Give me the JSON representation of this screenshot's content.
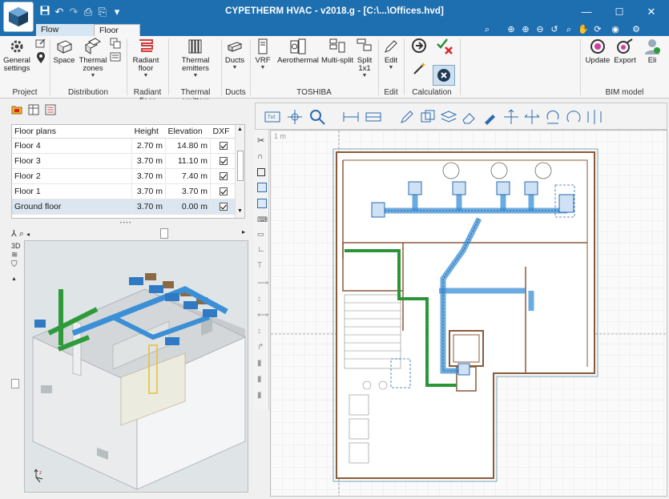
{
  "window": {
    "title": "CYPETHERM HVAC - v2018.g - [C:\\...\\Offices.hvd]",
    "minimize": "—",
    "maximize": "☐",
    "close": "✕"
  },
  "tabs": [
    {
      "label": "Flow diagrams"
    },
    {
      "label": "Floor plans"
    }
  ],
  "ribbon": {
    "buttons": {
      "general_settings": "General settings",
      "space": "Space",
      "thermal_zones": "Thermal zones",
      "radiant_floor": "Radiant floor",
      "thermal_emitters": "Thermal emitters",
      "ducts": "Ducts",
      "vrf": "VRF",
      "aerothermal": "Aerothermal",
      "multi_split": "Multi-split",
      "split_1x1": "Split 1x1",
      "edit": "Edit",
      "update": "Update",
      "export": "Export",
      "eli": "Eli"
    },
    "groups": {
      "project": "Project",
      "distribution": "Distribution",
      "radiant_floor": "Radiant floor",
      "thermal_emitters": "Thermal emitters",
      "ducts": "Ducts",
      "toshiba": "TOSHIBA",
      "edit": "Edit",
      "calculation": "Calculation",
      "bim_model": "BIM model"
    }
  },
  "floor_table": {
    "headers": {
      "name": "Floor plans",
      "height": "Height",
      "elevation": "Elevation",
      "dxf": "DXF"
    },
    "rows": [
      {
        "name": "Floor 4",
        "height": "2.70 m",
        "elevation": "14.80 m"
      },
      {
        "name": "Floor 3",
        "height": "3.70 m",
        "elevation": "11.10 m"
      },
      {
        "name": "Floor 2",
        "height": "3.70 m",
        "elevation": "7.40 m"
      },
      {
        "name": "Floor 1",
        "height": "3.70 m",
        "elevation": "3.70 m"
      },
      {
        "name": "Ground floor",
        "height": "3.70 m",
        "elevation": "0.00 m"
      }
    ],
    "selected_row": 4
  },
  "canvas": {
    "scale_label": "1 m"
  },
  "colors": {
    "titlebar": "#1e6fb0",
    "duct_blue": "#3a8fd6",
    "duct_green": "#2e9a3a",
    "wall": "#8a5a3a"
  }
}
